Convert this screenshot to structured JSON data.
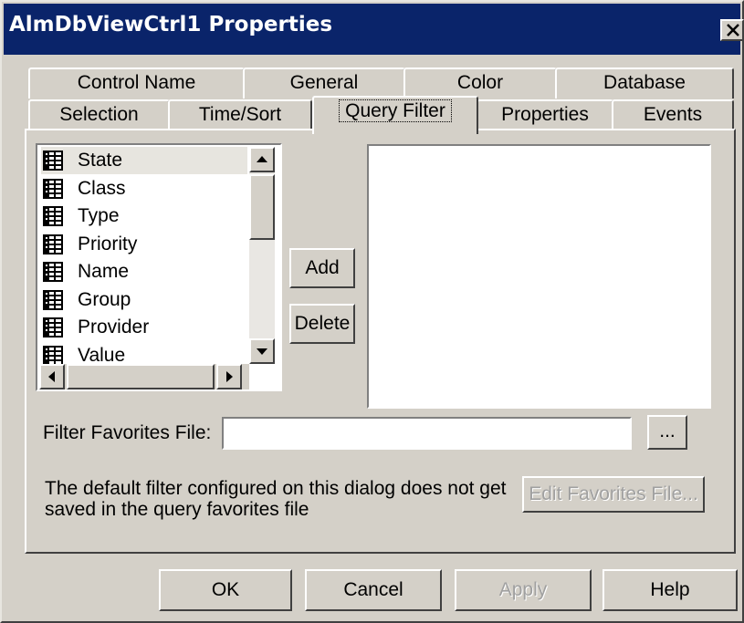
{
  "window": {
    "title": "AlmDbViewCtrl1 Properties",
    "close_label": "✕"
  },
  "tabs_row1": [
    "Control Name",
    "General",
    "Color",
    "Database"
  ],
  "tabs_row2": [
    "Selection",
    "Time/Sort",
    "Query Filter",
    "Properties",
    "Events"
  ],
  "active_tab": "Query Filter",
  "fields_list": {
    "items": [
      "State",
      "Class",
      "Type",
      "Priority",
      "Name",
      "Group",
      "Provider",
      "Value"
    ],
    "selected": "State",
    "item_icon": "table-icon"
  },
  "buttons": {
    "add": "Add",
    "delete": "Delete",
    "browse": "...",
    "edit_favorites": "Edit Favorites File..."
  },
  "filter_favorites": {
    "label": "Filter Favorites File:",
    "value": ""
  },
  "note": {
    "line1": "The default filter configured on this dialog does not get",
    "line2": "saved in the query favorites file"
  },
  "footer": {
    "ok": "OK",
    "cancel": "Cancel",
    "apply": "Apply",
    "help": "Help"
  },
  "colors": {
    "title_bar": "#0a246a",
    "dialog_bg": "#d4d0c8"
  }
}
